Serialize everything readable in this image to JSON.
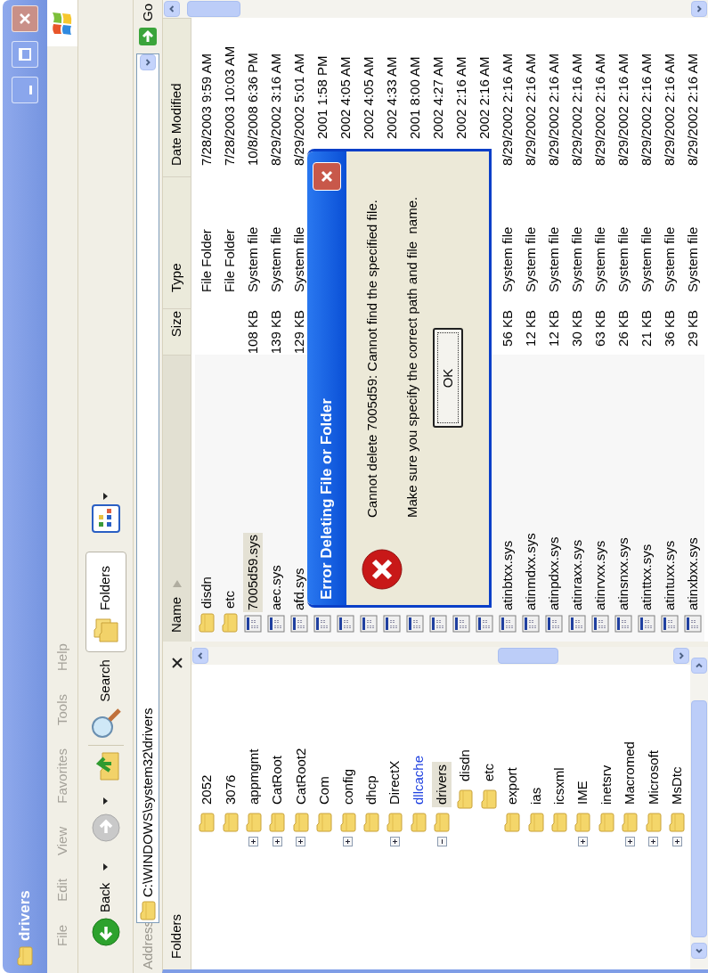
{
  "window": {
    "title": "drivers"
  },
  "menu": [
    "File",
    "Edit",
    "View",
    "Favorites",
    "Tools",
    "Help"
  ],
  "toolbar": {
    "back": "Back",
    "search": "Search",
    "folders": {
      "label": "Folders",
      "selected": true
    }
  },
  "address": {
    "label": "Address",
    "value": "C:\\WINDOWS\\system32\\drivers",
    "go": "Go"
  },
  "folders_pane": {
    "title": "Folders",
    "tree": [
      {
        "label": "2052",
        "selected": false,
        "hot": false
      },
      {
        "label": "3076",
        "selected": false,
        "hot": false
      },
      {
        "label": "appmgmt",
        "expanded": false,
        "selected": false,
        "hot": false
      },
      {
        "label": "CatRoot",
        "expanded": false,
        "selected": false,
        "hot": false
      },
      {
        "label": "CatRoot2",
        "expanded": false,
        "selected": false,
        "hot": false
      },
      {
        "label": "Com",
        "selected": false,
        "hot": false
      },
      {
        "label": "config",
        "expanded": false,
        "selected": false,
        "hot": false
      },
      {
        "label": "dhcp",
        "selected": false,
        "hot": false
      },
      {
        "label": "DirectX",
        "expanded": false,
        "selected": false,
        "hot": false
      },
      {
        "label": "dllcache",
        "selected": false,
        "hot": true
      },
      {
        "label": "drivers",
        "expanded": true,
        "selected": true,
        "hot": false,
        "children": [
          {
            "label": "disdn",
            "selected": false,
            "hot": false
          },
          {
            "label": "etc",
            "selected": false,
            "hot": false
          }
        ]
      },
      {
        "label": "export",
        "selected": false,
        "hot": false
      },
      {
        "label": "ias",
        "selected": false,
        "hot": false
      },
      {
        "label": "icsxml",
        "selected": false,
        "hot": false
      },
      {
        "label": "IME",
        "expanded": false,
        "selected": false,
        "hot": false
      },
      {
        "label": "inetsrv",
        "selected": false,
        "hot": false
      },
      {
        "label": "Macromed",
        "expanded": false,
        "selected": false,
        "hot": false
      },
      {
        "label": "Microsoft",
        "expanded": false,
        "selected": false,
        "hot": false
      },
      {
        "label": "MsDtc",
        "expanded": false,
        "selected": false,
        "hot": false
      }
    ]
  },
  "file_list": {
    "columns": [
      {
        "label": "Name",
        "sorted": true
      },
      {
        "label": "Size",
        "sorted": false
      },
      {
        "label": "Type",
        "sorted": false
      },
      {
        "label": "Date Modified",
        "sorted": false
      }
    ],
    "rows": [
      {
        "kind": "folder",
        "name": "disdn",
        "type": "File Folder",
        "date": "7/28/2003 9:59 AM",
        "selected": false
      },
      {
        "kind": "folder",
        "name": "etc",
        "type": "File Folder",
        "date": "7/28/2003 10:03 AM",
        "selected": false
      },
      {
        "kind": "file",
        "name": "7005d59.sys",
        "size": "108 KB",
        "type": "System file",
        "date": "10/8/2008 6:36 PM",
        "selected": true
      },
      {
        "kind": "file",
        "name": "aec.sys",
        "size": "139 KB",
        "type": "System file",
        "date": "8/29/2002 3:16 AM",
        "selected": false
      },
      {
        "kind": "file",
        "name": "afd.sys",
        "size": "129 KB",
        "type": "System file",
        "date": "8/29/2002 5:01 AM",
        "selected": false
      },
      {
        "kind": "file",
        "date": "2001 1:58 PM",
        "selected": false
      },
      {
        "kind": "file",
        "date": "2002 4:05 AM",
        "selected": false
      },
      {
        "kind": "file",
        "date": "2002 4:05 AM",
        "selected": false
      },
      {
        "kind": "file",
        "date": "2002 4:33 AM",
        "selected": false
      },
      {
        "kind": "file",
        "date": "2001 8:00 AM",
        "selected": false
      },
      {
        "kind": "file",
        "date": "2002 4:27 AM",
        "selected": false
      },
      {
        "kind": "file",
        "date": "2002 2:16 AM",
        "selected": false
      },
      {
        "kind": "file",
        "date": "2002 2:16 AM",
        "selected": false
      },
      {
        "kind": "file",
        "name": "atinbtxx.sys",
        "size": "56 KB",
        "type": "System file",
        "date": "8/29/2002 2:16 AM",
        "selected": false
      },
      {
        "kind": "file",
        "name": "atinmdxx.sys",
        "size": "12 KB",
        "type": "System file",
        "date": "8/29/2002 2:16 AM",
        "selected": false
      },
      {
        "kind": "file",
        "name": "atinpdxx.sys",
        "size": "12 KB",
        "type": "System file",
        "date": "8/29/2002 2:16 AM",
        "selected": false
      },
      {
        "kind": "file",
        "name": "atinraxx.sys",
        "size": "30 KB",
        "type": "System file",
        "date": "8/29/2002 2:16 AM",
        "selected": false
      },
      {
        "kind": "file",
        "name": "atinrvxx.sys",
        "size": "63 KB",
        "type": "System file",
        "date": "8/29/2002 2:16 AM",
        "selected": false
      },
      {
        "kind": "file",
        "name": "atinsnxx.sys",
        "size": "26 KB",
        "type": "System file",
        "date": "8/29/2002 2:16 AM",
        "selected": false
      },
      {
        "kind": "file",
        "name": "atinttxx.sys",
        "size": "21 KB",
        "type": "System file",
        "date": "8/29/2002 2:16 AM",
        "selected": false
      },
      {
        "kind": "file",
        "name": "atintuxx.sys",
        "size": "36 KB",
        "type": "System file",
        "date": "8/29/2002 2:16 AM",
        "selected": false
      },
      {
        "kind": "file",
        "name": "atinxbxx.sys",
        "size": "29 KB",
        "type": "System file",
        "date": "8/29/2002 2:16 AM",
        "selected": false
      }
    ]
  },
  "dialog": {
    "title": "Error Deleting File or Folder",
    "lines": [
      "Cannot delete 7005d59: Cannot find the specified file.",
      "Make sure you specify the correct path and file  name."
    ],
    "button": "OK"
  }
}
